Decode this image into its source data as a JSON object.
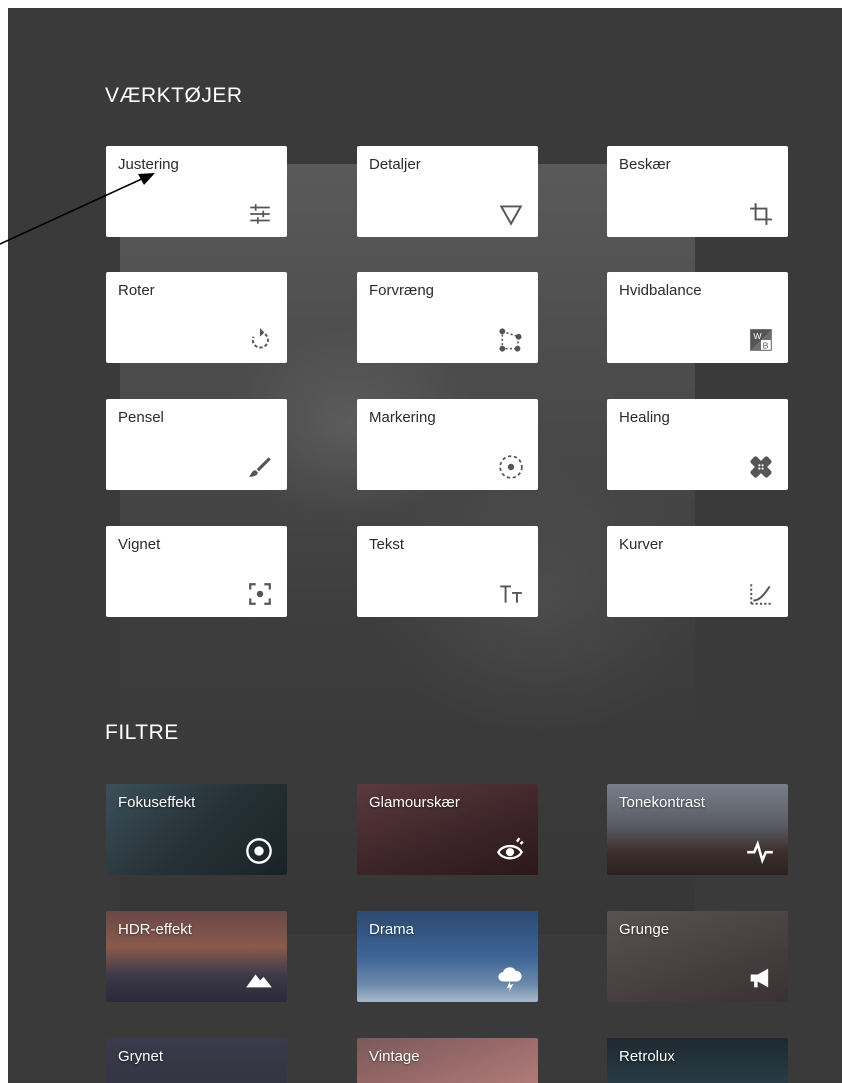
{
  "tools": {
    "title": "VÆRKTØJER",
    "items": [
      {
        "label": "Justering",
        "icon": "tune-sliders-icon"
      },
      {
        "label": "Detaljer",
        "icon": "triangle-down-icon"
      },
      {
        "label": "Beskær",
        "icon": "crop-icon"
      },
      {
        "label": "Roter",
        "icon": "rotate-icon"
      },
      {
        "label": "Forvræng",
        "icon": "perspective-icon"
      },
      {
        "label": "Hvidbalance",
        "icon": "white-balance-icon"
      },
      {
        "label": "Pensel",
        "icon": "brush-icon"
      },
      {
        "label": "Markering",
        "icon": "selective-icon"
      },
      {
        "label": "Healing",
        "icon": "bandage-icon"
      },
      {
        "label": "Vignet",
        "icon": "vignette-icon"
      },
      {
        "label": "Tekst",
        "icon": "text-icon"
      },
      {
        "label": "Kurver",
        "icon": "curves-icon"
      }
    ]
  },
  "filters": {
    "title": "FILTRE",
    "items": [
      {
        "label": "Fokuseffekt",
        "icon": "focus-circle-icon"
      },
      {
        "label": "Glamourskær",
        "icon": "eye-glow-icon"
      },
      {
        "label": "Tonekontrast",
        "icon": "pulse-icon"
      },
      {
        "label": "HDR-effekt",
        "icon": "mountain-icon"
      },
      {
        "label": "Drama",
        "icon": "storm-cloud-icon"
      },
      {
        "label": "Grunge",
        "icon": "megaphone-icon"
      },
      {
        "label": "Grynet",
        "icon": ""
      },
      {
        "label": "Vintage",
        "icon": ""
      },
      {
        "label": "Retrolux",
        "icon": ""
      }
    ]
  },
  "colors": {
    "background": "#3a3a3a",
    "tile": "#ffffff",
    "tile_text": "#2b2b2b",
    "icon": "#555555"
  }
}
